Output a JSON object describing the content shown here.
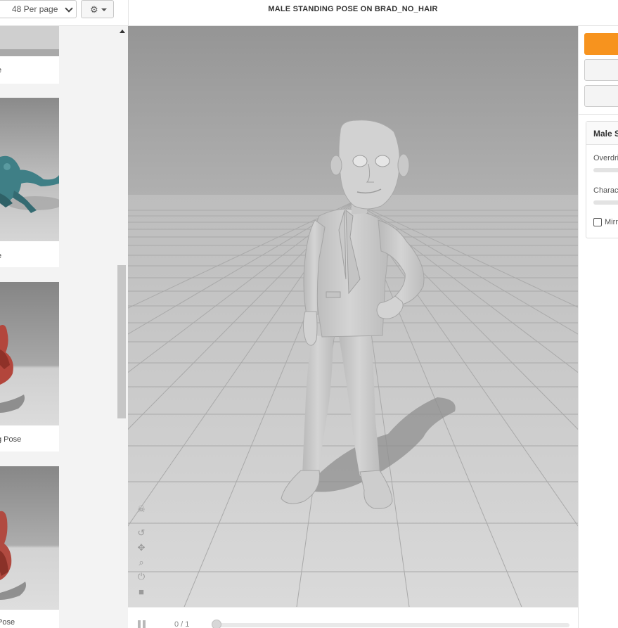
{
  "toolbar": {
    "per_page": "48 Per page",
    "settings_icon": "gear-icon",
    "dropdown_icon": "caret-down-icon"
  },
  "viewer": {
    "title": "MALE STANDING POSE ON BRAD_NO_HAIR",
    "frame_counter": "0 / 1",
    "timeline_progress": 0.0,
    "tools": [
      "skull-icon",
      "reset-icon",
      "move-icon",
      "zoom-icon",
      "power-icon",
      "camera-icon"
    ]
  },
  "library": {
    "items": [
      {
        "label": "e"
      },
      {
        "label": "e"
      },
      {
        "label": "g Pose"
      },
      {
        "label": "Pose"
      }
    ]
  },
  "options": {
    "header": "Male S",
    "overdrive_label": "Overdri",
    "character_label": "Charac",
    "mirror_label": "Mirr"
  },
  "colors": {
    "accent": "#f7931e",
    "floor": "#cfcfcf",
    "background": "#9c9c9c"
  }
}
